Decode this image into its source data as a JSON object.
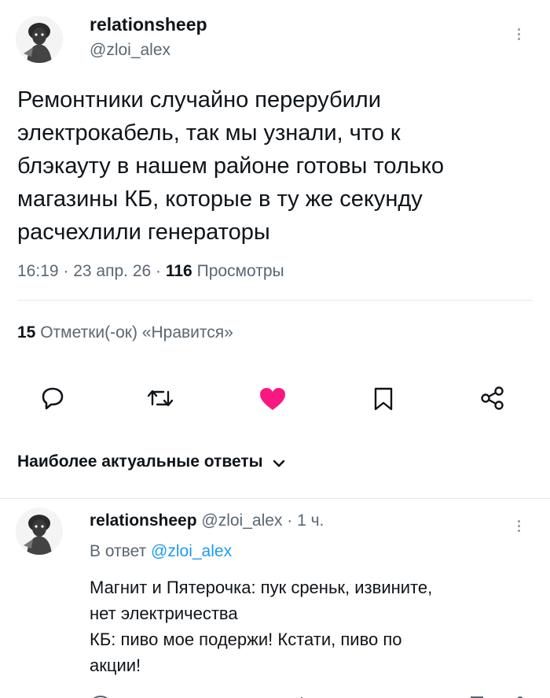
{
  "tweet": {
    "author_name": "relationsheep",
    "author_handle": "@zloi_alex",
    "text_lines": [
      "Ремонтники случайно перерубили",
      "электрокабель, так мы узнали, что к",
      "блэкауту в нашем районе готовы только",
      "магазины КБ, которые в ту же секунду",
      "расчехлили генераторы"
    ],
    "time": "16:19",
    "date": "23 апр. 26",
    "views_count": "116",
    "views_label": "Просмотры",
    "likes_count": "15",
    "likes_label": "Отметки(-ок) «Нравится»"
  },
  "actions": {
    "icons": [
      "reply-icon",
      "retweet-icon",
      "like-icon",
      "bookmark-icon",
      "share-icon"
    ],
    "like_color": "#f91880"
  },
  "replies_section": {
    "sort_label": "Наиболее актуальные ответы"
  },
  "reply": {
    "author_name": "relationsheep",
    "author_handle": "@zloi_alex",
    "time_ago": "1 ч.",
    "in_reply_prefix": "В ответ",
    "in_reply_handle": "@zloi_alex",
    "text_lines": [
      "Магнит и Пятерочка: пук среньк, извините,",
      "нет электричества",
      "КБ: пиво мое подержи! Кстати, пиво по",
      "акции!"
    ]
  }
}
